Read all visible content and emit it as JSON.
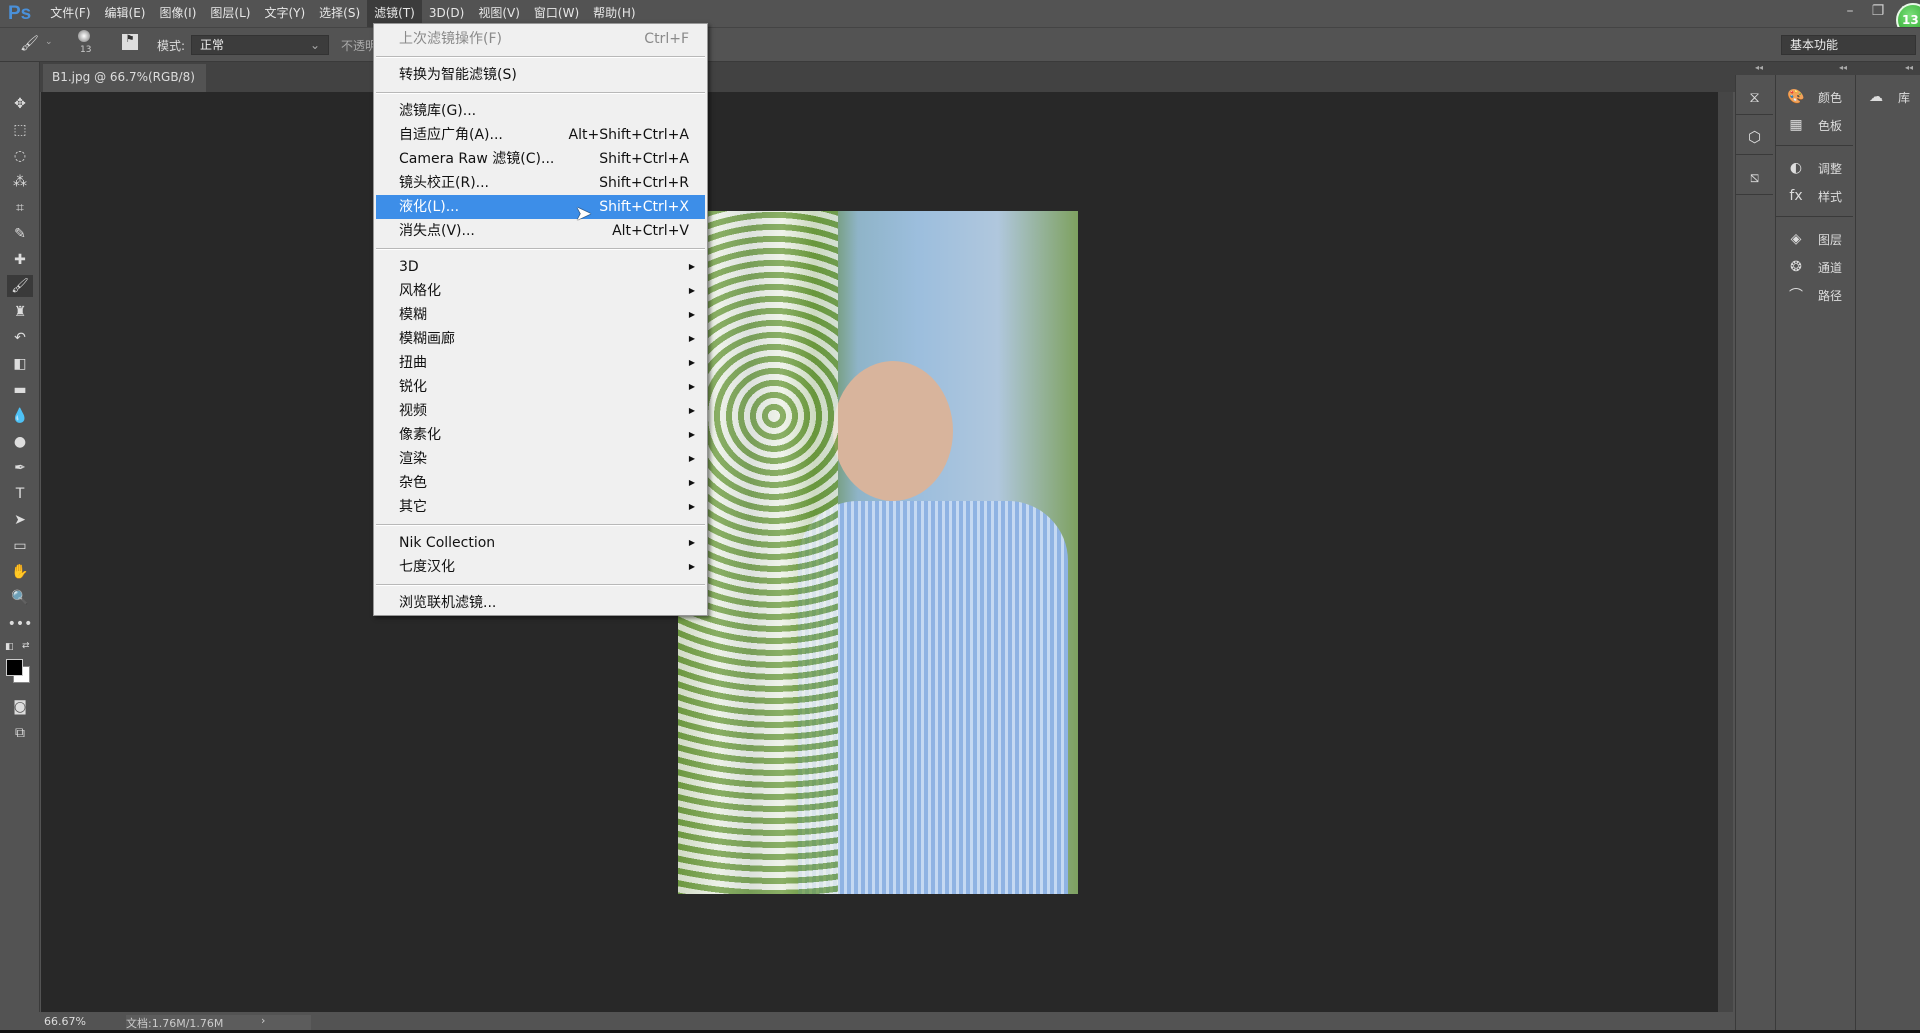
{
  "app": {
    "logo": "Ps",
    "menu": [
      "文件(F)",
      "编辑(E)",
      "图像(I)",
      "图层(L)",
      "文字(Y)",
      "选择(S)",
      "滤镜(T)",
      "3D(D)",
      "视图(V)",
      "窗口(W)",
      "帮助(H)"
    ],
    "active_menu": "滤镜(T)",
    "window_controls": [
      "–",
      "❐",
      "✕"
    ],
    "badge": "13"
  },
  "options": {
    "brush_size": "13",
    "mode_label": "模式:",
    "mode_value": "正常",
    "opacity_label": "不透明",
    "workspace": "基本功能"
  },
  "document": {
    "tab": "B1.jpg @ 66.7%(RGB/8)",
    "close": "×",
    "zoom": "66.67%",
    "doc_info": "文档:1.76M/1.76M",
    "arrow": "›"
  },
  "filter_menu": {
    "groups": [
      [
        {
          "label": "上次滤镜操作(F)",
          "shortcut": "Ctrl+F",
          "disabled": true
        }
      ],
      [
        {
          "label": "转换为智能滤镜(S)",
          "shortcut": ""
        }
      ],
      [
        {
          "label": "滤镜库(G)...",
          "shortcut": ""
        },
        {
          "label": "自适应广角(A)...",
          "shortcut": "Alt+Shift+Ctrl+A"
        },
        {
          "label": "Camera Raw 滤镜(C)...",
          "shortcut": "Shift+Ctrl+A"
        },
        {
          "label": "镜头校正(R)...",
          "shortcut": "Shift+Ctrl+R"
        },
        {
          "label": "液化(L)...",
          "shortcut": "Shift+Ctrl+X",
          "highlighted": true
        },
        {
          "label": "消失点(V)...",
          "shortcut": "Alt+Ctrl+V"
        }
      ],
      [
        {
          "label": "3D",
          "submenu": true
        },
        {
          "label": "风格化",
          "submenu": true
        },
        {
          "label": "模糊",
          "submenu": true
        },
        {
          "label": "模糊画廊",
          "submenu": true
        },
        {
          "label": "扭曲",
          "submenu": true
        },
        {
          "label": "锐化",
          "submenu": true
        },
        {
          "label": "视频",
          "submenu": true
        },
        {
          "label": "像素化",
          "submenu": true
        },
        {
          "label": "渲染",
          "submenu": true
        },
        {
          "label": "杂色",
          "submenu": true
        },
        {
          "label": "其它",
          "submenu": true
        }
      ],
      [
        {
          "label": "Nik Collection",
          "submenu": true
        },
        {
          "label": "七度汉化",
          "submenu": true
        }
      ],
      [
        {
          "label": "浏览联机滤镜...",
          "shortcut": ""
        }
      ]
    ],
    "highlight_color": "#3d8ee8"
  },
  "panels": {
    "col2": [
      {
        "icon": "palette-icon",
        "glyph": "🎨",
        "label": "颜色"
      },
      {
        "icon": "swatches-icon",
        "glyph": "▦",
        "label": "色板"
      },
      {
        "icon": "adjustments-icon",
        "glyph": "◐",
        "label": "调整"
      },
      {
        "icon": "styles-icon",
        "glyph": "fx",
        "label": "样式"
      },
      {
        "icon": "layers-icon",
        "glyph": "◈",
        "label": "图层"
      },
      {
        "icon": "channels-icon",
        "glyph": "❂",
        "label": "通道"
      },
      {
        "icon": "paths-icon",
        "glyph": "⌒",
        "label": "路径"
      }
    ],
    "col3": [
      {
        "icon": "creative-cloud-icon",
        "glyph": "☁",
        "label": "库"
      }
    ]
  },
  "tools": [
    {
      "n": "move-tool",
      "g": "✥"
    },
    {
      "n": "marquee-tool",
      "g": "⬚"
    },
    {
      "n": "lasso-tool",
      "g": "◌"
    },
    {
      "n": "magic-wand-tool",
      "g": "⁂"
    },
    {
      "n": "crop-tool",
      "g": "⌗"
    },
    {
      "n": "eyedropper-tool",
      "g": "✎"
    },
    {
      "n": "healing-brush-tool",
      "g": "✚"
    },
    {
      "n": "brush-tool",
      "g": "🖌"
    },
    {
      "n": "clone-stamp-tool",
      "g": "♜"
    },
    {
      "n": "history-brush-tool",
      "g": "↶"
    },
    {
      "n": "eraser-tool",
      "g": "◧"
    },
    {
      "n": "gradient-tool",
      "g": "▬"
    },
    {
      "n": "blur-tool",
      "g": "💧"
    },
    {
      "n": "dodge-tool",
      "g": "●"
    },
    {
      "n": "pen-tool",
      "g": "✒"
    },
    {
      "n": "type-tool",
      "g": "T"
    },
    {
      "n": "path-selection-tool",
      "g": "➤"
    },
    {
      "n": "rectangle-tool",
      "g": "▭"
    },
    {
      "n": "hand-tool",
      "g": "✋"
    },
    {
      "n": "zoom-tool",
      "g": "🔍"
    },
    {
      "n": "more-tools",
      "g": "•••"
    }
  ]
}
